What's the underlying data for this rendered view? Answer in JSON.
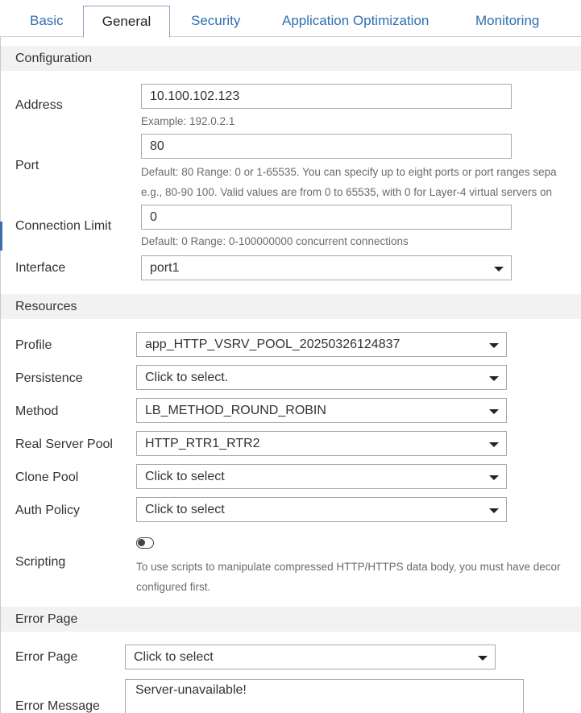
{
  "tabs": [
    {
      "label": "Basic"
    },
    {
      "label": "General"
    },
    {
      "label": "Security"
    },
    {
      "label": "Application Optimization"
    },
    {
      "label": "Monitoring"
    }
  ],
  "active_tab": "General",
  "configuration": {
    "header": "Configuration",
    "address": {
      "label": "Address",
      "value": "10.100.102.123",
      "hint": "Example: 192.0.2.1"
    },
    "port": {
      "label": "Port",
      "value": "80",
      "hint_line1": "Default: 80 Range: 0 or 1-65535. You can specify up to eight ports or port ranges sepa",
      "hint_line2": "e.g., 80-90 100. Valid values are from 0 to 65535, with 0 for Layer-4 virtual servers on"
    },
    "connection_limit": {
      "label": "Connection Limit",
      "value": "0",
      "hint": "Default: 0 Range: 0-100000000 concurrent connections"
    },
    "interface": {
      "label": "Interface",
      "value": "port1"
    }
  },
  "resources": {
    "header": "Resources",
    "profile": {
      "label": "Profile",
      "value": "app_HTTP_VSRV_POOL_20250326124837"
    },
    "persistence": {
      "label": "Persistence",
      "value": "Click to select."
    },
    "method": {
      "label": "Method",
      "value": "LB_METHOD_ROUND_ROBIN"
    },
    "real_server_pool": {
      "label": "Real Server Pool",
      "value": "HTTP_RTR1_RTR2"
    },
    "clone_pool": {
      "label": "Clone Pool",
      "value": "Click to select"
    },
    "auth_policy": {
      "label": "Auth Policy",
      "value": "Click to select"
    },
    "scripting": {
      "label": "Scripting",
      "enabled": false,
      "hint_line1": "To use scripts to manipulate compressed HTTP/HTTPS data body, you must have decor",
      "hint_line2": "configured first."
    }
  },
  "error_page_section": {
    "header": "Error Page",
    "error_page": {
      "label": "Error Page",
      "value": "Click to select"
    },
    "error_message": {
      "label": "Error Message",
      "value": "Server-unavailable!"
    }
  },
  "icons": {
    "dropdown": "caret-down-icon",
    "toggle": "toggle-switch-icon"
  },
  "colors": {
    "tab_link": "#2f6fae",
    "section_bg": "#f2f2f2",
    "hint_text": "#6b6b6b",
    "input_border": "#a9a9a9"
  }
}
